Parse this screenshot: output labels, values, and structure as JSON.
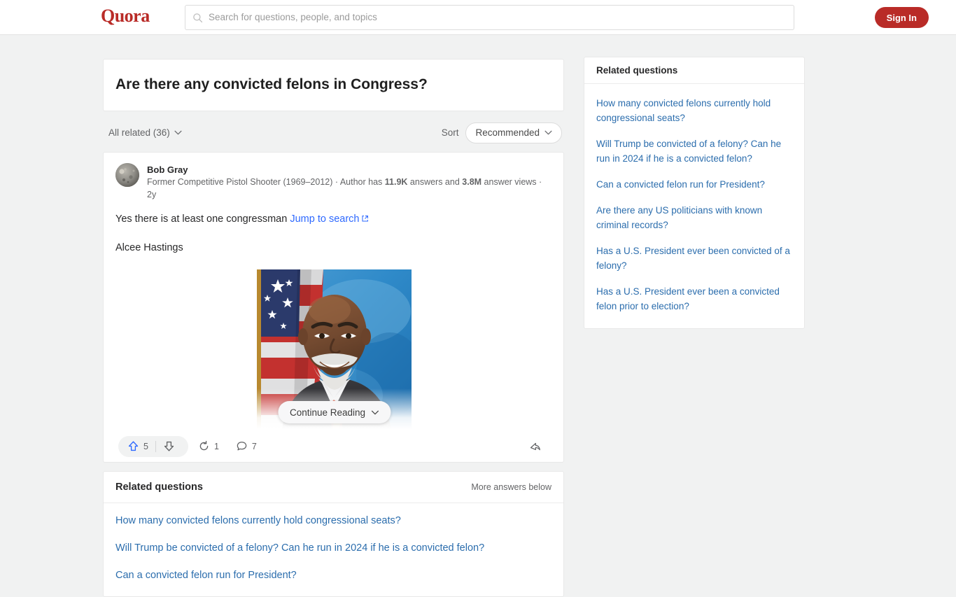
{
  "header": {
    "logo_text": "Quora",
    "logo_color": "#b92b27",
    "search_placeholder": "Search for questions, people, and topics",
    "search_value": "",
    "signin_label": "Sign In"
  },
  "question": {
    "title": "Are there any convicted felons in Congress?"
  },
  "filter_bar": {
    "all_related_label": "All related (36)",
    "sort_label": "Sort",
    "sort_value": "Recommended"
  },
  "answer": {
    "author_name": "Bob Gray",
    "credential_prefix": "Former Competitive Pistol Shooter (1969–2012) · Author has ",
    "answers_count": "11.9K",
    "credential_mid": " answers and ",
    "views_count": "3.8M",
    "credential_suffix": " answer views ·",
    "timestamp": "2y",
    "paragraph_1": "Yes there is at least one congressman ",
    "paragraph_1_link": "Jump to search",
    "paragraph_2": "Alcee Hastings",
    "continue_label": "Continue Reading",
    "actions": {
      "upvote_count": "5",
      "downvote_count": "",
      "repost_count": "1",
      "comment_count": "7"
    }
  },
  "related_main": {
    "title": "Related questions",
    "more_label": "More answers below",
    "items": [
      "How many convicted felons currently hold congressional seats?",
      "Will Trump be convicted of a felony? Can he run in 2024 if he is a convicted felon?",
      "Can a convicted felon run for President?"
    ]
  },
  "related_sidebar": {
    "title": "Related questions",
    "items": [
      "How many convicted felons currently hold congressional seats?",
      "Will Trump be convicted of a felony? Can he run in 2024 if he is a convicted felon?",
      "Can a convicted felon run for President?",
      "Are there any US politicians with known criminal records?",
      "Has a U.S. President ever been convicted of a felony?",
      "Has a U.S. President ever been a convicted felon prior to election?"
    ]
  },
  "colors": {
    "brand_red": "#b92b27",
    "link_blue": "#2b6dad",
    "inline_link_blue": "#2e69ff",
    "page_bg": "#f1f2f2",
    "upvote_blue": "#2e69ff"
  }
}
